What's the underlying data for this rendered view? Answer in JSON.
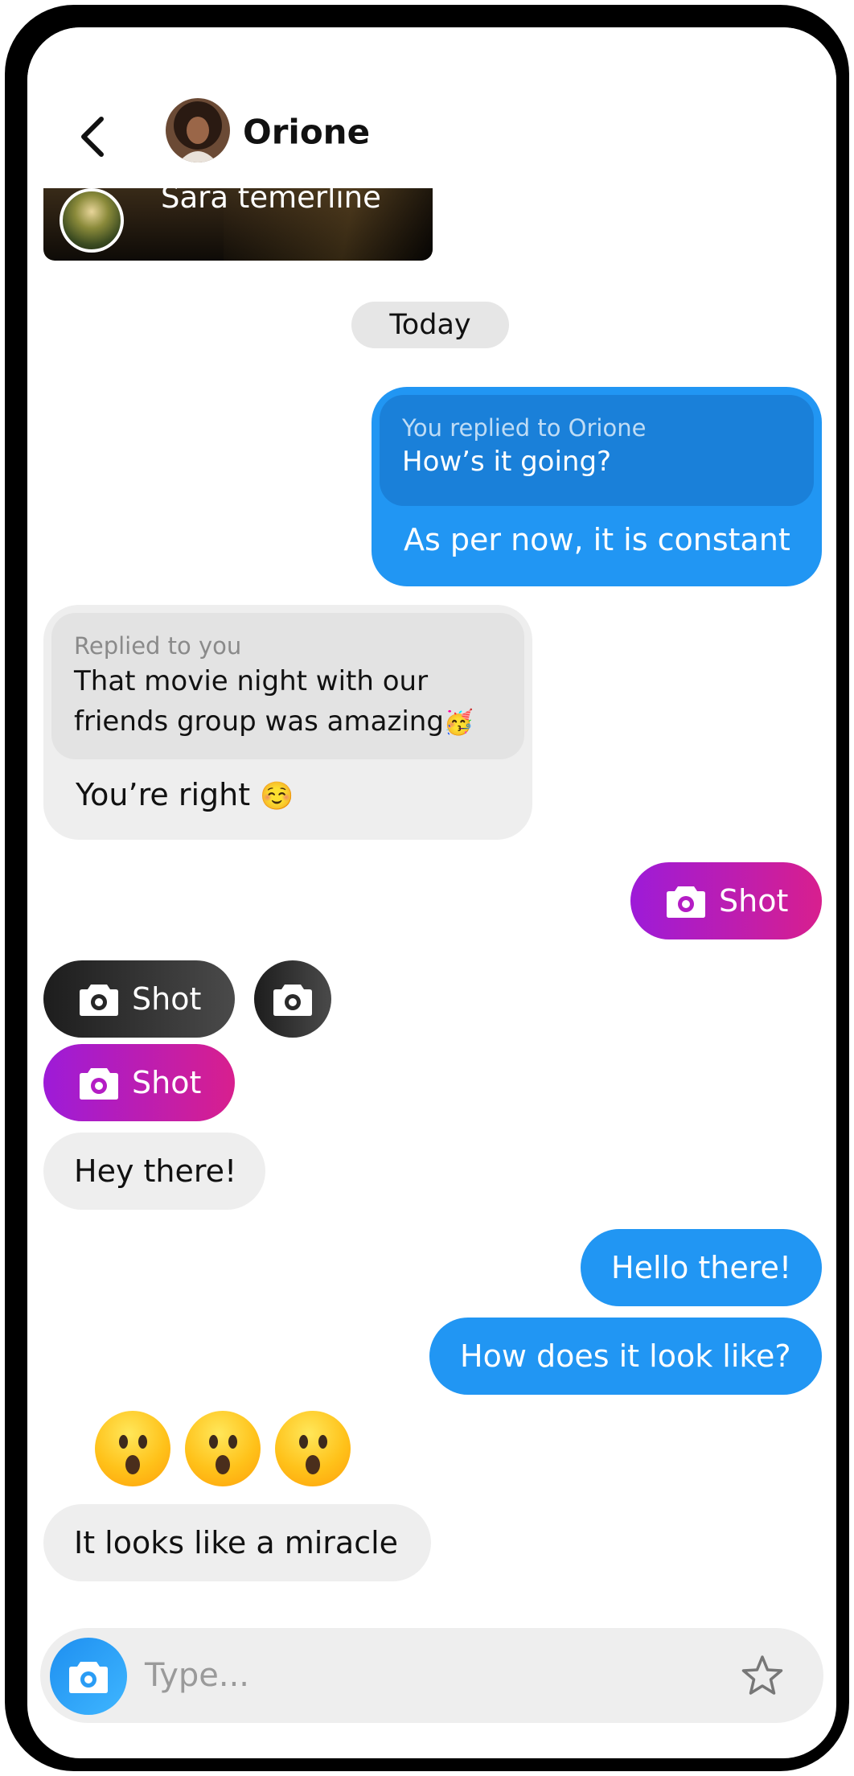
{
  "header": {
    "title": "Orione"
  },
  "story": {
    "name": "Sara temerline"
  },
  "date_divider": "Today",
  "messages": {
    "m1": {
      "quote_label": "You replied to Orione",
      "quote_text": "How’s it going?",
      "text": "As per now, it is constant"
    },
    "m2": {
      "quote_label": "Replied to you",
      "quote_line1": "That movie night with our",
      "quote_line2": "friends group was amazing",
      "quote_emoji": "🥳",
      "text": "You’re right",
      "text_emoji": "☺️"
    },
    "m3": {
      "label": "Shot"
    },
    "m4": {
      "label": "Shot"
    },
    "m6": {
      "label": "Shot"
    },
    "m7": {
      "text": "Hey there!"
    },
    "m8": {
      "text": "Hello there!"
    },
    "m9": {
      "text": "How does it look like?"
    },
    "m10": {
      "text": "It looks like a miracle"
    }
  },
  "composer": {
    "placeholder": "Type..."
  },
  "colors": {
    "outgoing": "#2196F3",
    "incoming": "#EEEEEE",
    "shot_gradient_start": "#9D1BD8",
    "shot_gradient_end": "#D81F8E"
  },
  "icons": [
    "back-chevron-icon",
    "camera-icon",
    "star-icon",
    "astonished-emoji-icon"
  ]
}
